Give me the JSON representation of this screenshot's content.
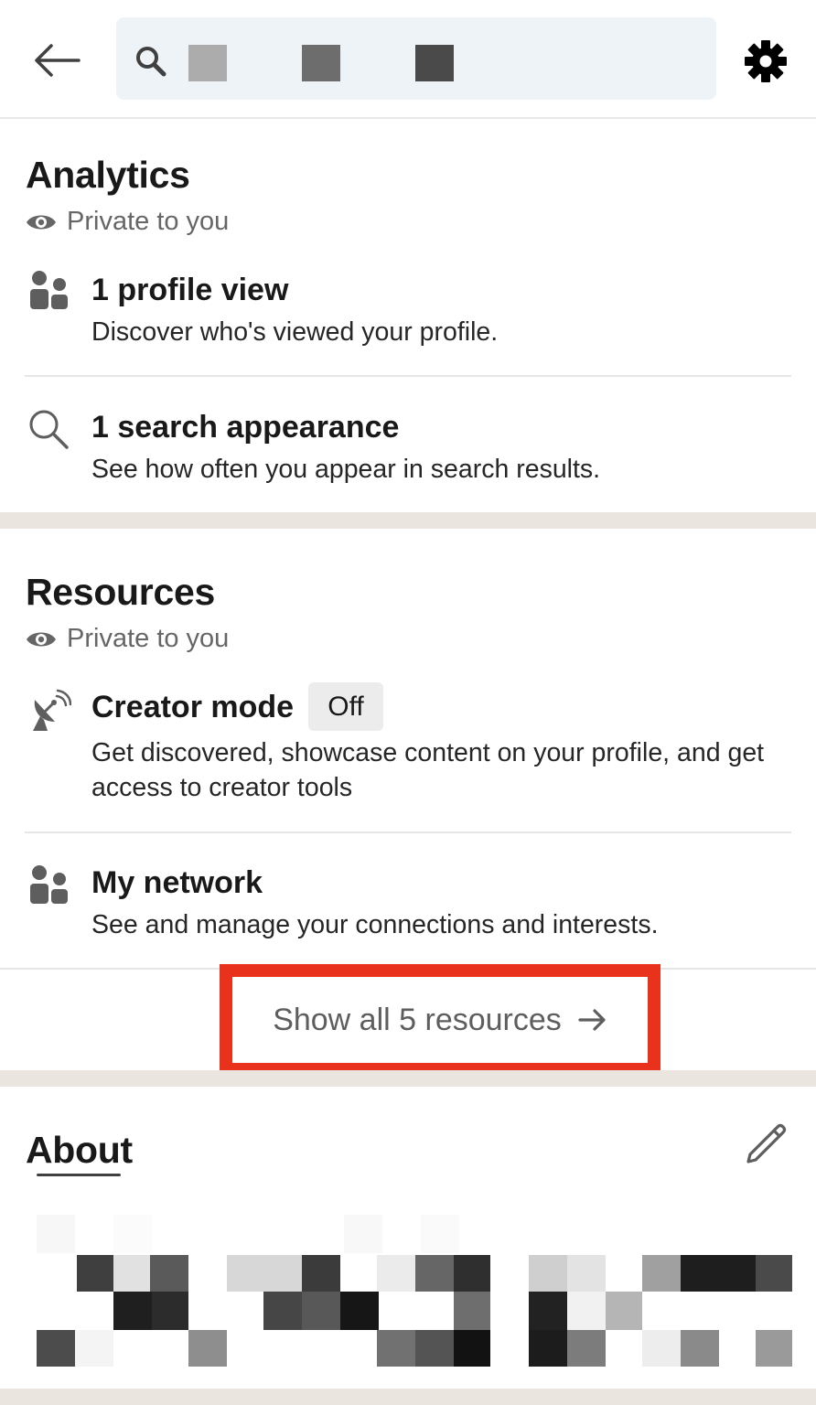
{
  "header": {
    "search_query": "",
    "icons": {
      "back": "arrow-left-icon",
      "search": "search-icon",
      "settings": "gear-icon"
    }
  },
  "analytics": {
    "title": "Analytics",
    "privacy": "Private to you",
    "items": [
      {
        "title": "1 profile view",
        "description": "Discover who's viewed your profile.",
        "icon": "people-icon"
      },
      {
        "title": "1 search appearance",
        "description": "See how often you appear in search results.",
        "icon": "search-icon"
      }
    ]
  },
  "resources": {
    "title": "Resources",
    "privacy": "Private to you",
    "items": [
      {
        "title": "Creator mode",
        "badge": "Off",
        "description": "Get discovered, showcase content on your profile, and get access to creator tools",
        "icon": "satellite-dish-icon"
      },
      {
        "title": "My network",
        "description": "See and manage your connections and interests.",
        "icon": "people-icon"
      }
    ],
    "show_all": "Show all 5 resources"
  },
  "about": {
    "title": "About",
    "edit_icon": "pencil-icon"
  },
  "colors": {
    "highlight": "#e8321c",
    "search_bg": "#eef3f8",
    "section_gap": "#eae6df",
    "muted_text": "#666666"
  }
}
